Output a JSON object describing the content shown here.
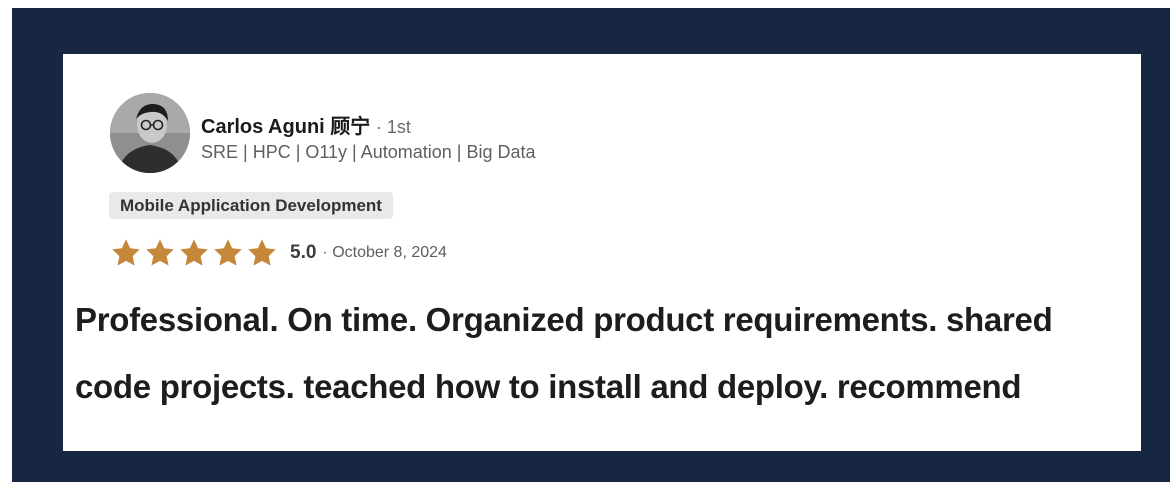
{
  "colors": {
    "frame": "#172641",
    "star": "#c6873a",
    "tag_bg": "#e9e9e9"
  },
  "reviewer": {
    "name": "Carlos Aguni 顾宁",
    "degree": "· 1st",
    "headline": "SRE | HPC | O11y | Automation | Big Data",
    "avatar_icon": "profile-photo"
  },
  "service_tag": "Mobile Application Development",
  "rating": {
    "stars": 5,
    "score": "5.0",
    "date": "· October 8, 2024"
  },
  "review": {
    "line1": "Professional. On time. Organized product requirements. shared",
    "line2": "code projects. teached how to  install and deploy. recommend"
  }
}
